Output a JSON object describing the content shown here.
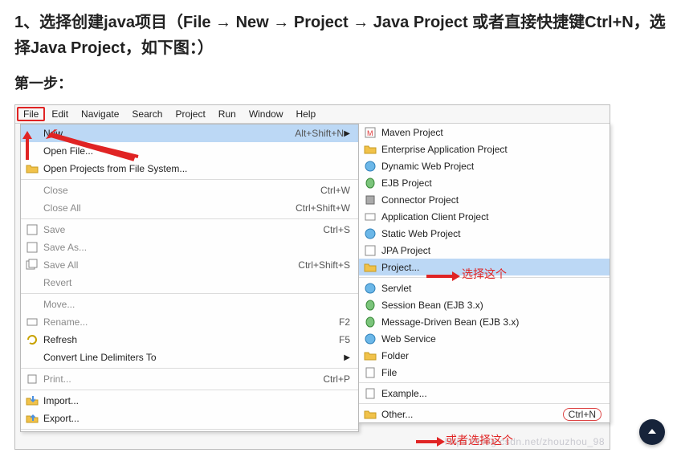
{
  "heading": "1、选择创建java项目（File → New → Project → Java Project 或者直接快捷键Ctrl+N，选择Java Project，如下图：）",
  "step_label": "第一步：",
  "menubar": [
    "File",
    "Edit",
    "Navigate",
    "Search",
    "Project",
    "Run",
    "Window",
    "Help"
  ],
  "file_menu": {
    "new": {
      "label": "New",
      "shortcut": "Alt+Shift+N"
    },
    "open_file": {
      "label": "Open File..."
    },
    "open_projects": {
      "label": "Open Projects from File System..."
    },
    "close": {
      "label": "Close",
      "shortcut": "Ctrl+W"
    },
    "close_all": {
      "label": "Close All",
      "shortcut": "Ctrl+Shift+W"
    },
    "save": {
      "label": "Save",
      "shortcut": "Ctrl+S"
    },
    "save_as": {
      "label": "Save As..."
    },
    "save_all": {
      "label": "Save All",
      "shortcut": "Ctrl+Shift+S"
    },
    "revert": {
      "label": "Revert"
    },
    "move": {
      "label": "Move..."
    },
    "rename": {
      "label": "Rename...",
      "shortcut": "F2"
    },
    "refresh": {
      "label": "Refresh",
      "shortcut": "F5"
    },
    "convert": {
      "label": "Convert Line Delimiters To"
    },
    "print": {
      "label": "Print...",
      "shortcut": "Ctrl+P"
    },
    "import": {
      "label": "Import..."
    },
    "export": {
      "label": "Export..."
    }
  },
  "new_submenu": {
    "maven": {
      "label": "Maven Project"
    },
    "ear": {
      "label": "Enterprise Application Project"
    },
    "dynweb": {
      "label": "Dynamic Web Project"
    },
    "ejb": {
      "label": "EJB Project"
    },
    "conn": {
      "label": "Connector Project"
    },
    "appcli": {
      "label": "Application Client Project"
    },
    "statweb": {
      "label": "Static Web Project"
    },
    "jpa": {
      "label": "JPA Project"
    },
    "project": {
      "label": "Project..."
    },
    "servlet": {
      "label": "Servlet"
    },
    "session": {
      "label": "Session Bean (EJB 3.x)"
    },
    "mdb": {
      "label": "Message-Driven Bean (EJB 3.x)"
    },
    "websvc": {
      "label": "Web Service"
    },
    "folder": {
      "label": "Folder"
    },
    "file": {
      "label": "File"
    },
    "example": {
      "label": "Example..."
    },
    "other": {
      "label": "Other...",
      "shortcut": "Ctrl+N"
    }
  },
  "annotations": {
    "choose_this": "选择这个",
    "or_choose_this": "或者选择这个"
  },
  "watermark": "https://blog.csdn.net/zhouzhou_98"
}
